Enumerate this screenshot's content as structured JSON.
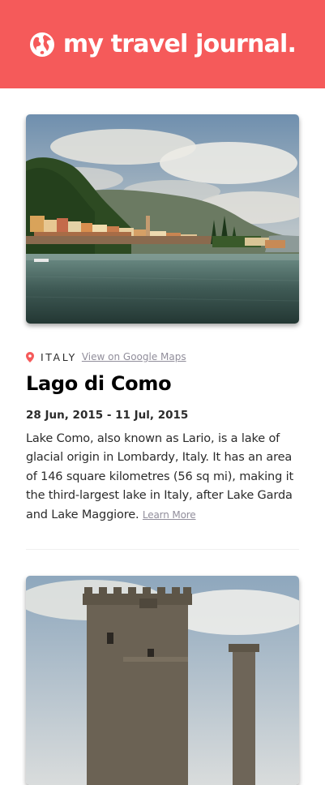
{
  "header": {
    "title": "my travel journal.",
    "icon": "globe-icon",
    "background": "#F55A5A"
  },
  "entries": [
    {
      "image": "lake-como-photo",
      "country": "ITALY",
      "maps_link_label": "View on Google Maps",
      "title": "Lago di Como",
      "dates": "28 Jun, 2015 - 11 Jul, 2015",
      "description": "Lake Como, also known as Lario, is a lake of glacial origin in Lombardy, Italy. It has an area of 146 square kilometres (56 sq mi), making it the third-largest lake in Italy, after Lake Garda and Lake Maggiore.",
      "learn_more_label": "Learn More"
    },
    {
      "image": "castle-tower-photo"
    }
  ]
}
